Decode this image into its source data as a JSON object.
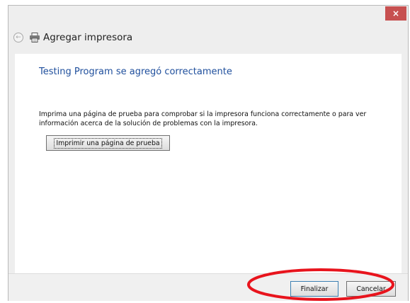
{
  "window": {
    "close_glyph": "×",
    "title": "Agregar impresora"
  },
  "nav": {
    "back_icon": "back-arrow-icon",
    "printer_icon": "printer-icon"
  },
  "content": {
    "heading": "Testing Program se agregó correctamente",
    "body": "Imprima una página de prueba para comprobar si la impresora funciona correctamente o para ver información acerca de la solución de problemas con la impresora.",
    "test_page_button": "Imprimir una página de prueba"
  },
  "footer": {
    "finish_button": "Finalizar",
    "cancel_button": "Cancelar"
  },
  "annotation": {
    "color": "#e8141d"
  }
}
